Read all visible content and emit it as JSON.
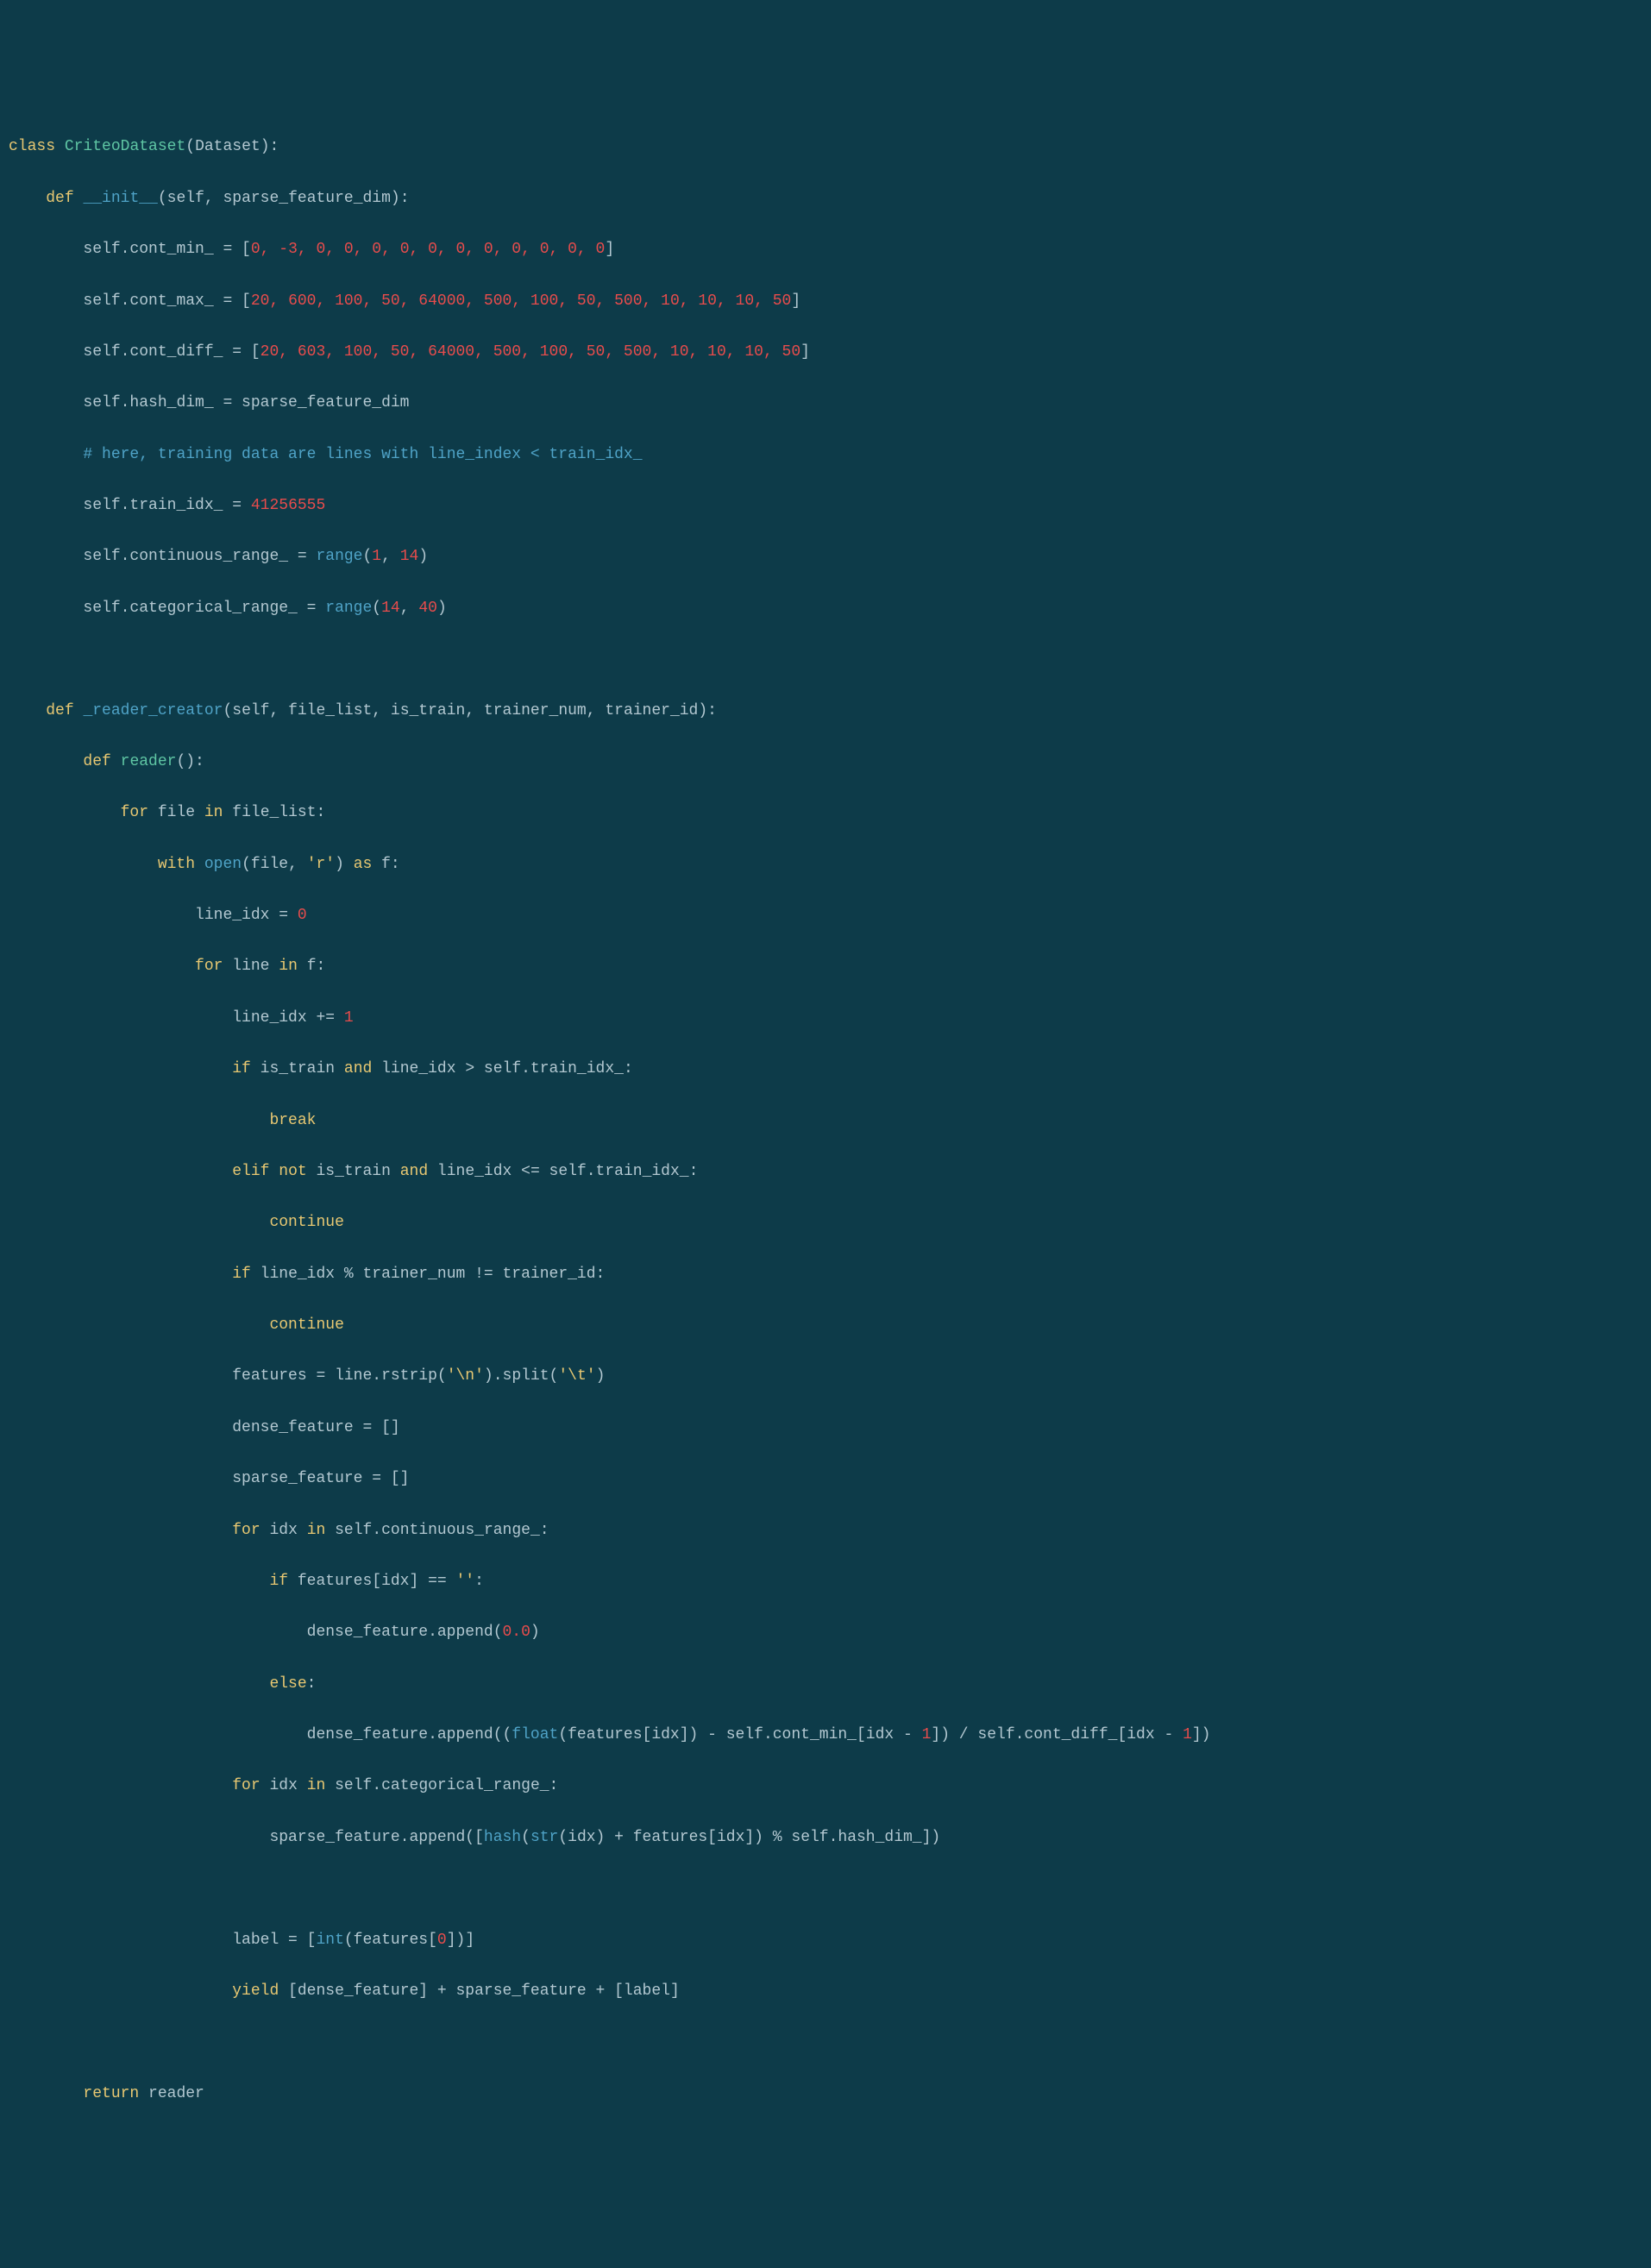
{
  "code": {
    "class_kw": "class",
    "class_name": "CriteoDataset",
    "base": "Dataset",
    "def_kw": "def",
    "init_name": "__init__",
    "init_params": "(self, sparse_feature_dim):",
    "cont_min_lhs": "self.cont_min_ = [",
    "cont_min_vals": "0, -3, 0, 0, 0, 0, 0, 0, 0, 0, 0, 0, 0",
    "cont_max_lhs": "self.cont_max_ = [",
    "cont_max_vals": "20, 600, 100, 50, 64000, 500, 100, 50, 500, 10, 10, 10, 50",
    "cont_diff_lhs": "self.cont_diff_ = [",
    "cont_diff_vals": "20, 603, 100, 50, 64000, 500, 100, 50, 500, 10, 10, 10, 50",
    "hash_dim": "self.hash_dim_ = sparse_feature_dim",
    "comment_line": "# here, training data are lines with line_index < train_idx_",
    "train_idx_lhs": "self.train_idx_ = ",
    "train_idx_val": "41256555",
    "cont_range_lhs": "self.continuous_range_ = ",
    "range_fn": "range",
    "cont_range_args": "(1, 14)",
    "cat_range_lhs": "self.categorical_range_ = ",
    "cat_range_args": "(14, 40)",
    "reader_creator_name": "_reader_creator",
    "reader_creator_params": "(self, file_list, is_train, trainer_num, trainer_id):",
    "reader_name": "reader",
    "reader_params": "():",
    "for_kw": "for",
    "in_kw": "in",
    "file_var": "file",
    "file_list_var": "file_list:",
    "with_kw": "with",
    "open_fn": "open",
    "open_args1": "(file, ",
    "r_str": "'r'",
    "open_args2": ") ",
    "as_kw": "as",
    "f_var": " f:",
    "line_idx_init": "line_idx = ",
    "zero": "0",
    "line_var": "line",
    "f_iter": "f:",
    "line_idx_inc": "line_idx += ",
    "one": "1",
    "if_kw": "if",
    "and_kw": "and",
    "is_train_cond1": " is_train ",
    "gt_cond": " line_idx > self.train_idx_:",
    "break_kw": "break",
    "elif_kw": "elif",
    "not_kw": "not",
    "is_train_cond2": " is_train ",
    "le_cond": " line_idx <= self.train_idx_:",
    "continue_kw": "continue",
    "mod_cond": " line_idx % trainer_num != trainer_id:",
    "features_lhs": "features = line.rstrip(",
    "newline_str": "'\\n'",
    "split_mid": ").split(",
    "tab_str": "'\\t'",
    "close_paren": ")",
    "dense_init": "dense_feature = []",
    "sparse_init": "sparse_feature = []",
    "idx_var": "idx",
    "self_cont_range": "self.continuous_range_:",
    "features_idx_cond": " features[idx] == ",
    "empty_str": "''",
    "colon": ":",
    "dense_append1": "dense_feature.append(",
    "zero_float": "0.0",
    "else_kw": "else",
    "dense_append2_a": "dense_feature.append((",
    "float_fn": "float",
    "dense_append2_b": "(features[idx]) - self.cont_min_[idx - ",
    "dense_append2_c": "]) / self.cont_diff_[idx - ",
    "dense_append2_d": "])",
    "self_cat_range": "self.categorical_range_:",
    "sparse_append_a": "sparse_feature.append([",
    "hash_fn": "hash",
    "sparse_append_b": "(",
    "str_fn": "str",
    "sparse_append_c": "(idx) + features[idx]) % self.hash_dim_])",
    "label_a": "label = [",
    "int_fn": "int",
    "label_b": "(features[",
    "label_c": "])]",
    "yield_kw": "yield",
    "yield_expr": " [dense_feature] + sparse_feature + [label]",
    "return_kw": "return",
    "return_var": " reader"
  }
}
